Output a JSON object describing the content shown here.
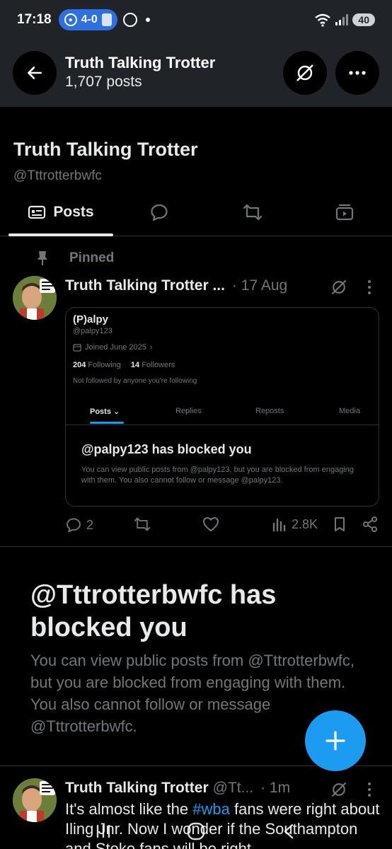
{
  "status_bar": {
    "time": "17:18",
    "score": "4-0",
    "battery": "40",
    "wifi_label": "6"
  },
  "header": {
    "title": "Truth Talking Trotter",
    "post_count": "1,707 posts",
    "icons": [
      "back-arrow-icon",
      "grok-icon",
      "more-icon"
    ]
  },
  "profile": {
    "name": "Truth Talking Trotter",
    "handle": "@Tttrotterbwfc"
  },
  "tabs": {
    "posts_label": "Posts",
    "icons": [
      "posts-icon",
      "replies-icon",
      "reposts-icon",
      "media-icon"
    ]
  },
  "pinned": {
    "label": "Pinned",
    "tweet": {
      "name": "Truth Talking Trotter ...",
      "time": "· 17 Aug",
      "embed": {
        "name": "(P)alpy",
        "handle": "@palpy123",
        "joined": "Joined June 2025",
        "following_count": "204",
        "following_label": "Following",
        "followers_count": "14",
        "followers_label": "Followers",
        "not_followed": "Not followed by anyone you're following",
        "tabs": [
          "Posts",
          "Replies",
          "Reposts",
          "Media"
        ],
        "blocked_title": "@palpy123 has blocked you",
        "blocked_body": "You can view public posts from @palpy123, but you are blocked from engaging with them. You also cannot follow or message @palpy123."
      },
      "actions": {
        "replies": "2",
        "views": "2.8K"
      }
    }
  },
  "blocked_notice": {
    "title": "@Tttrotterbwfc has blocked you",
    "body": "You can view public posts from @Tttrotterbwfc, but you are blocked from engaging with them. You also cannot follow or message @Tttrotterbwfc."
  },
  "second_tweet": {
    "name": "Truth Talking Trotter",
    "handle": "@Tt...",
    "time": "· 1m",
    "text_before": "It's almost like the ",
    "hashtag": "#wba",
    "text_after": " fans were right about Iling Jnr. Now I wonder if the Southampton and Stoke fans will be right"
  },
  "colors": {
    "background": "#000000",
    "header_bg": "#202327",
    "accent": "#1d9bf0",
    "text_primary": "#e7e9ea",
    "text_secondary": "#71767b",
    "score_pill": "#2f6fe0"
  }
}
